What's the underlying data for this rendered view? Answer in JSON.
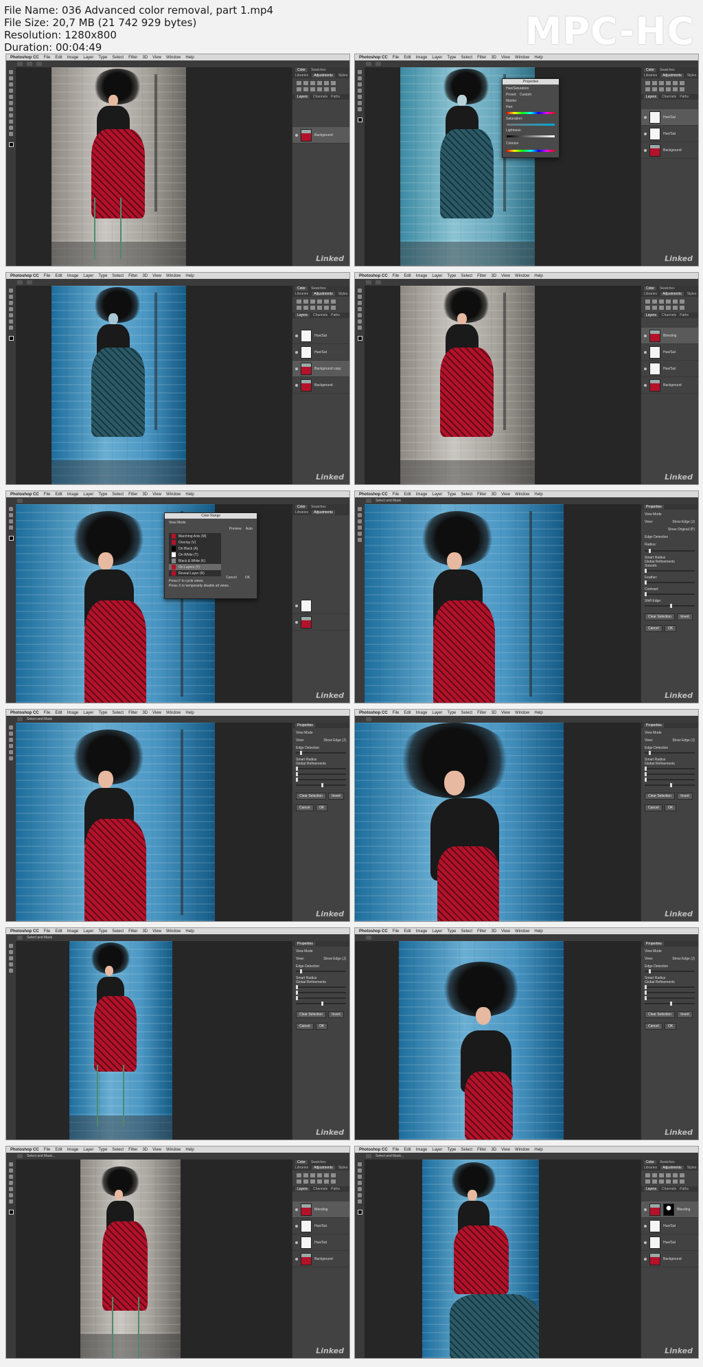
{
  "header": {
    "file_name": "File Name: 036 Advanced color removal, part 1.mp4",
    "file_size": "File Size: 20,7 MB (21 742 929 bytes)",
    "resolution": "Resolution: 1280x800",
    "duration": "Duration: 00:04:49"
  },
  "logo": "MPC-HC",
  "app_menu": [
    "Photoshop CC",
    "File",
    "Edit",
    "Image",
    "Layer",
    "Type",
    "Select",
    "Filter",
    "3D",
    "View",
    "Window",
    "Help"
  ],
  "watermark": "Linked",
  "panel_tabs": {
    "color": "Color",
    "swatches": "Swatches",
    "libraries": "Libraries",
    "adjustments": "Adjustments",
    "styles": "Styles",
    "layers": "Layers",
    "channels": "Channels",
    "paths": "Paths",
    "properties": "Properties"
  },
  "layers": {
    "background": "Background",
    "background_copy": "Background copy",
    "hue_sat": "Hue/Sat",
    "blending": "Blending"
  },
  "properties_panel": {
    "hue_saturation": "Hue/Saturation",
    "preset": "Preset:",
    "preset_value": "Custom",
    "master": "Master",
    "hue": "Hue:",
    "saturation": "Saturation:",
    "lightness": "Lightness:",
    "colorize": "Colorize"
  },
  "refine": {
    "view_mode": "View Mode",
    "view": "View:",
    "show_edge": "Show Edge (J)",
    "show_original": "Show Original (P)",
    "edge_detection": "Edge Detection",
    "radius": "Radius:",
    "smart_radius": "Smart Radius",
    "global_refinements": "Global Refinements",
    "smooth": "Smooth:",
    "feather": "Feather:",
    "contrast": "Contrast:",
    "shift_edge": "Shift Edge:",
    "clear_selection": "Clear Selection",
    "invert": "Invert",
    "cancel": "Cancel",
    "ok": "OK",
    "select_and_mask": "Select and Mask",
    "options_hint": "Select and Mask..."
  },
  "color_range_dialog": {
    "title": "Color Range",
    "view_mode": "View Mode",
    "preview": "Preview",
    "modes": [
      "Marching Ants (M)",
      "Overlay (V)",
      "On Black (A)",
      "On White (T)",
      "Black & White (K)",
      "On Layers (Y)",
      "Reveal Layer (R)"
    ],
    "selected_mode": "On Layers (Y)",
    "cancel": "Cancel",
    "ok": "OK",
    "hint1": "Press F to cycle views.",
    "hint2": "Press X to temporarily disable all views.",
    "auto": "Auto"
  }
}
